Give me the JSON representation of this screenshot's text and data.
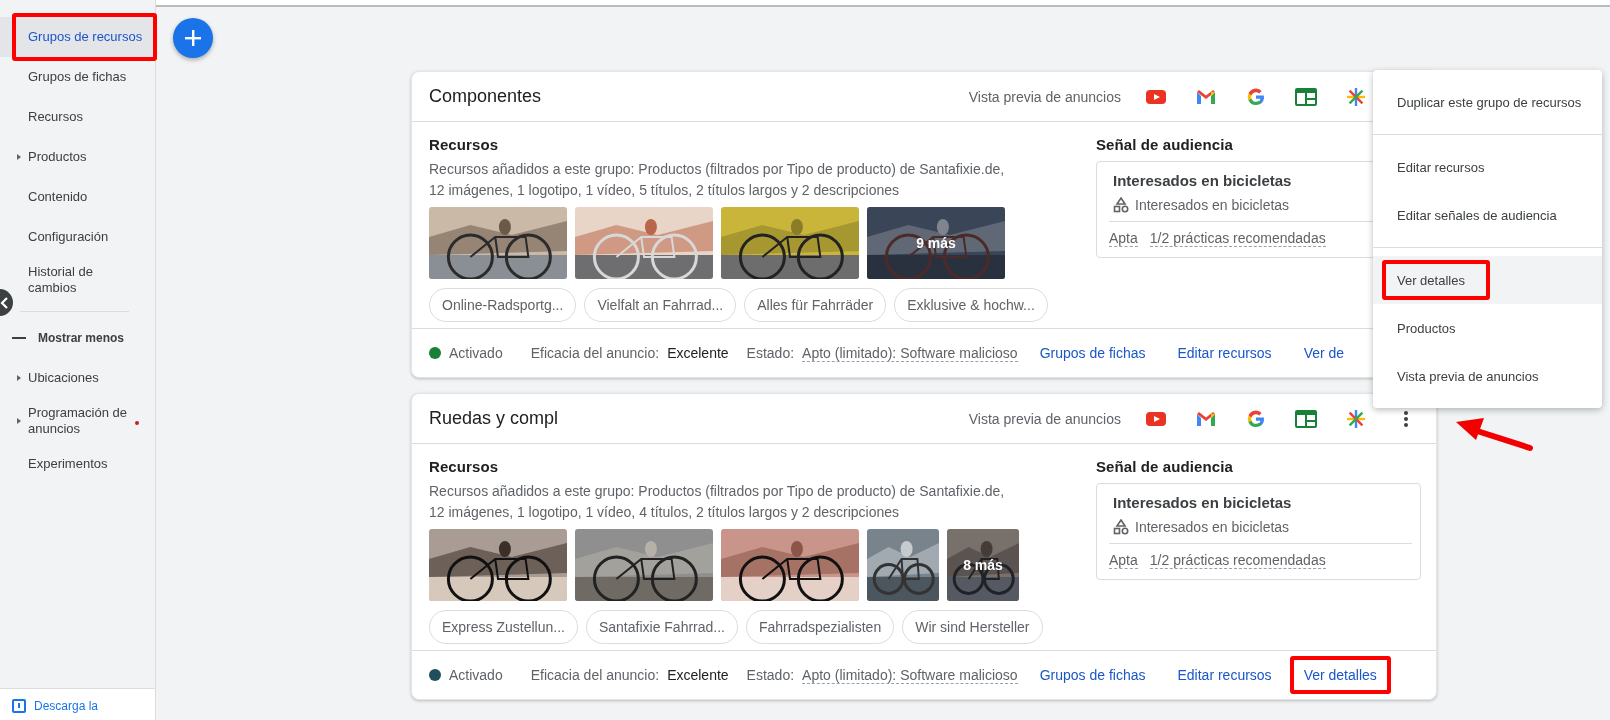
{
  "sidebar": {
    "items": [
      {
        "label": "Grupos de recursos",
        "kind": "link",
        "selected": true,
        "annotated": true
      },
      {
        "label": "Grupos de fichas",
        "kind": "link",
        "selected": false,
        "annotated": false
      },
      {
        "label": "Recursos",
        "kind": "link",
        "selected": false,
        "annotated": false
      },
      {
        "label": "Productos",
        "kind": "group",
        "selected": false,
        "annotated": false
      },
      {
        "label": "Contenido",
        "kind": "link",
        "selected": false,
        "annotated": false
      },
      {
        "label": "Configuración",
        "kind": "link",
        "selected": false,
        "annotated": false
      },
      {
        "label": "Historial de cambios",
        "kind": "link",
        "selected": false,
        "annotated": false
      },
      {
        "label": "Mostrar menos",
        "kind": "toggle"
      },
      {
        "label": "Ubicaciones",
        "kind": "group",
        "selected": false,
        "annotated": false
      },
      {
        "label": "Programación de anuncios",
        "kind": "group",
        "selected": false,
        "annotated": false,
        "alert": true
      },
      {
        "label": "Experimentos",
        "kind": "link",
        "selected": false,
        "annotated": false
      }
    ],
    "footer_link": "Descarga la"
  },
  "cards": [
    {
      "title": "Componentes",
      "preview_label": "Vista previa de anuncios",
      "menu_open": true,
      "pointed": false,
      "resources": {
        "heading": "Recursos",
        "description": "Recursos añadidos a este grupo: Productos (filtrados por Tipo de producto) de Santafixie.de, 12 imágenes, 1 logotipo, 1 vídeo, 5 títulos, 2 títulos largos y 2 descripciones",
        "thumbnails": [
          {
            "kind": "picture",
            "narrow": false
          },
          {
            "kind": "picture",
            "narrow": false
          },
          {
            "kind": "picture",
            "narrow": false
          },
          {
            "kind": "picture",
            "narrow": false,
            "overlay": "9 más"
          }
        ],
        "chips": [
          "Online-Radsportg...",
          "Vielfalt an Fahrrad...",
          "Alles für Fahrräder",
          "Exklusive & hochw..."
        ]
      },
      "audience": {
        "heading": "Señal de audiencia",
        "title": "Interesados en bicicletas",
        "item": "Interesados en bicicletas",
        "status": "Apta",
        "practices": "1/2 prácticas recomendadas"
      },
      "footer": {
        "status": {
          "label": "Activado",
          "color": "#188038"
        },
        "efficiency_label": "Eficacia del anuncio:",
        "efficiency": "Excelente",
        "state_label": "Estado:",
        "state": "Apto (limitado): Software malicioso",
        "links": [
          {
            "label": "Grupos de fichas",
            "annotated": false
          },
          {
            "label": "Editar recursos",
            "annotated": false
          },
          {
            "label": "Ver de",
            "annotated": false
          }
        ]
      }
    },
    {
      "title": "Ruedas y compl",
      "preview_label": "Vista previa de anuncios",
      "menu_open": false,
      "pointed": true,
      "resources": {
        "heading": "Recursos",
        "description": "Recursos añadidos a este grupo: Productos (filtrados por Tipo de producto) de Santafixie.de, 12 imágenes, 1 logotipo, 1 vídeo, 4 títulos, 2 títulos largos y 2 descripciones",
        "thumbnails": [
          {
            "kind": "picture",
            "narrow": false
          },
          {
            "kind": "picture",
            "narrow": false
          },
          {
            "kind": "picture",
            "narrow": false
          },
          {
            "kind": "picture",
            "narrow": true
          },
          {
            "kind": "picture",
            "narrow": true,
            "overlay": "8 más"
          }
        ],
        "chips": [
          "Express Zustellun...",
          "Santafixie Fahrrad...",
          "Fahrradspezialisten",
          "Wir sind Hersteller"
        ]
      },
      "audience": {
        "heading": "Señal de audiencia",
        "title": "Interesados en bicicletas",
        "item": "Interesados en bicicletas",
        "status": "Apta",
        "practices": "1/2 prácticas recomendadas"
      },
      "footer": {
        "status": {
          "label": "Activado",
          "color": "#1f4e5f"
        },
        "efficiency_label": "Eficacia del anuncio:",
        "efficiency": "Excelente",
        "state_label": "Estado:",
        "state": "Apto (limitado): Software malicioso",
        "links": [
          {
            "label": "Grupos de fichas",
            "annotated": false
          },
          {
            "label": "Editar recursos",
            "annotated": false
          },
          {
            "label": "Ver detalles",
            "annotated": true
          }
        ]
      }
    }
  ],
  "menu": {
    "groups": [
      [
        {
          "label": "Duplicar este grupo de recursos",
          "selected": false,
          "annotated": false
        }
      ],
      [
        {
          "label": "Editar recursos",
          "selected": false,
          "annotated": false
        },
        {
          "label": "Editar señales de audiencia",
          "selected": false,
          "annotated": false
        }
      ],
      [
        {
          "label": "Ver detalles",
          "selected": true,
          "annotated": true
        },
        {
          "label": "Productos",
          "selected": false,
          "annotated": false
        },
        {
          "label": "Vista previa de anuncios",
          "selected": false,
          "annotated": false
        }
      ]
    ]
  }
}
